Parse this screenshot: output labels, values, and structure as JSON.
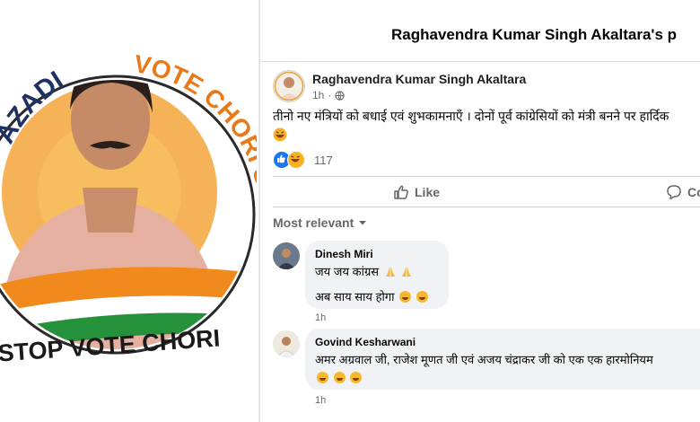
{
  "badge": {
    "arc_left": "AZADI",
    "arc_right": "VOTE CHORI SE AZADI",
    "bottom": "STOP VOTE CHORI"
  },
  "page_header": {
    "title": "Raghavendra Kumar Singh Akaltara's p"
  },
  "post": {
    "author": "Raghavendra Kumar Singh Akaltara",
    "time": "1h",
    "text": "तीनो नए मंत्रियों को बधाई एवं शुभकामनाएँ । दोनों पूर्व कांग्रेसियों को मंत्री बनने पर हार्दिक",
    "reaction_count": "117",
    "reaction_icons": [
      "like-icon",
      "haha-icon"
    ]
  },
  "actions": {
    "like_label": "Like",
    "comment_label": "Co"
  },
  "sort": {
    "label": "Most relevant"
  },
  "comments": [
    {
      "name": "Dinesh Miri",
      "line1": "जय जय कांग्रस",
      "line2": "अब साय साय होगा",
      "time": "1h"
    },
    {
      "name": "Govind Kesharwani",
      "line1": "अमर अग्रवाल जी, राजेश मूणत जी एवं अजय चंद्राकर जी को एक एक हारमोनियम",
      "time": "1h"
    }
  ],
  "colors": {
    "accent": "#1877f2",
    "badge_navy": "#1e3163",
    "badge_orange": "#f08a1c",
    "badge_green": "#25913a"
  }
}
